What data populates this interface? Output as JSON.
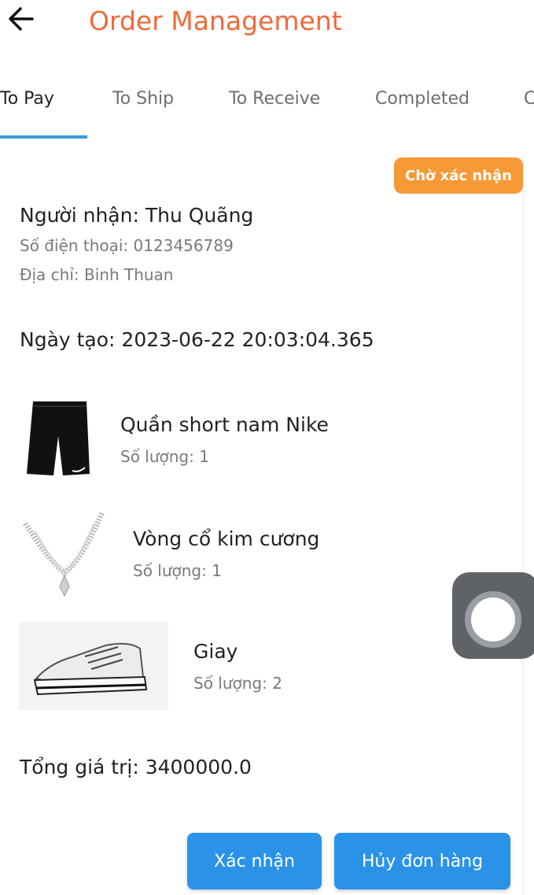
{
  "header": {
    "title": "Order Management",
    "back_icon": "arrow-left-icon"
  },
  "tabs": [
    {
      "label": "To Pay",
      "active": true
    },
    {
      "label": "To Ship"
    },
    {
      "label": "To Receive"
    },
    {
      "label": "Completed"
    },
    {
      "label": "C"
    }
  ],
  "colors": {
    "title": "#ef6a3a",
    "badge": "#f59a36",
    "button": "#2a93e8",
    "tab_indicator": "#3f98e2"
  },
  "order": {
    "status": "Chờ xác nhận",
    "recipient": "Người nhận: Thu Quãng",
    "phone": "Số điện thoại: 0123456789",
    "address": "Địa chỉ: Binh Thuan",
    "created": "Ngày tạo: 2023-06-22 20:03:04.365",
    "items": [
      {
        "name": "Quần short nam Nike",
        "qty": "Số lượng: 1",
        "icon": "shorts-image"
      },
      {
        "name": "Vòng cổ kim cương",
        "qty": "Số lượng: 1",
        "icon": "necklace-image"
      },
      {
        "name": "Giay",
        "qty": "Số lượng: 2",
        "icon": "sneaker-image"
      }
    ],
    "total": "Tổng giá trị: 3400000.0"
  },
  "actions": {
    "confirm": "Xác nhận",
    "cancel": "Hủy đơn hàng"
  }
}
